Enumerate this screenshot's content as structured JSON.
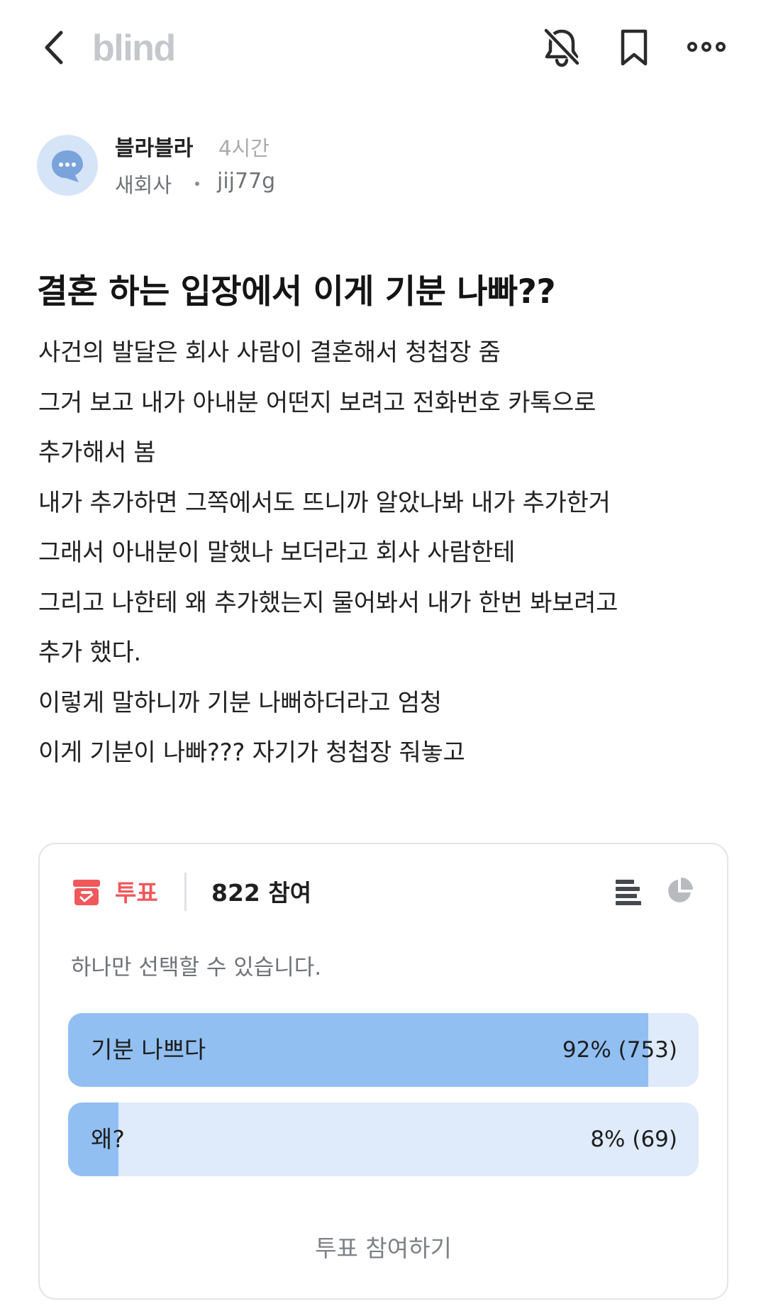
{
  "header": {
    "logo": "blind"
  },
  "author": {
    "name": "블라블라",
    "time": "4시간",
    "company": "새회사",
    "handle": "jij77g"
  },
  "post": {
    "title": "결혼 하는 입장에서 이게 기분 나빠??",
    "lines": [
      "사건의 발달은 회사 사람이 결혼해서 청첩장 줌",
      "그거 보고 내가 아내분 어떤지 보려고 전화번호 카톡으로",
      "추가해서 봄",
      "내가 추가하면 그쪽에서도 뜨니까 알았나봐 내가 추가한거",
      "그래서 아내분이 말했나 보더라고 회사 사람한테",
      "그리고 나한테 왜 추가했는지 물어봐서 내가 한번 봐보려고",
      "추가 했다.",
      "이렇게 말하니까 기분 나뻐하더라고 엄청",
      "이게 기분이 나빠??? 자기가 청첩장 줘놓고"
    ]
  },
  "poll": {
    "label": "투표",
    "count_text": "822 참여",
    "hint": "하나만 선택할 수 있습니다.",
    "options": [
      {
        "label": "기분 나쁘다",
        "result": "92% (753)",
        "fraction": 0.92
      },
      {
        "label": "왜?",
        "result": "8% (69)",
        "fraction": 0.08
      }
    ],
    "vote_button": "투표 참여하기"
  },
  "colors": {
    "accent_red": "#f0585b",
    "bar_fill": "#92bff2",
    "bar_track": "#dfeafa",
    "logo_gray": "#c4c7cc"
  }
}
